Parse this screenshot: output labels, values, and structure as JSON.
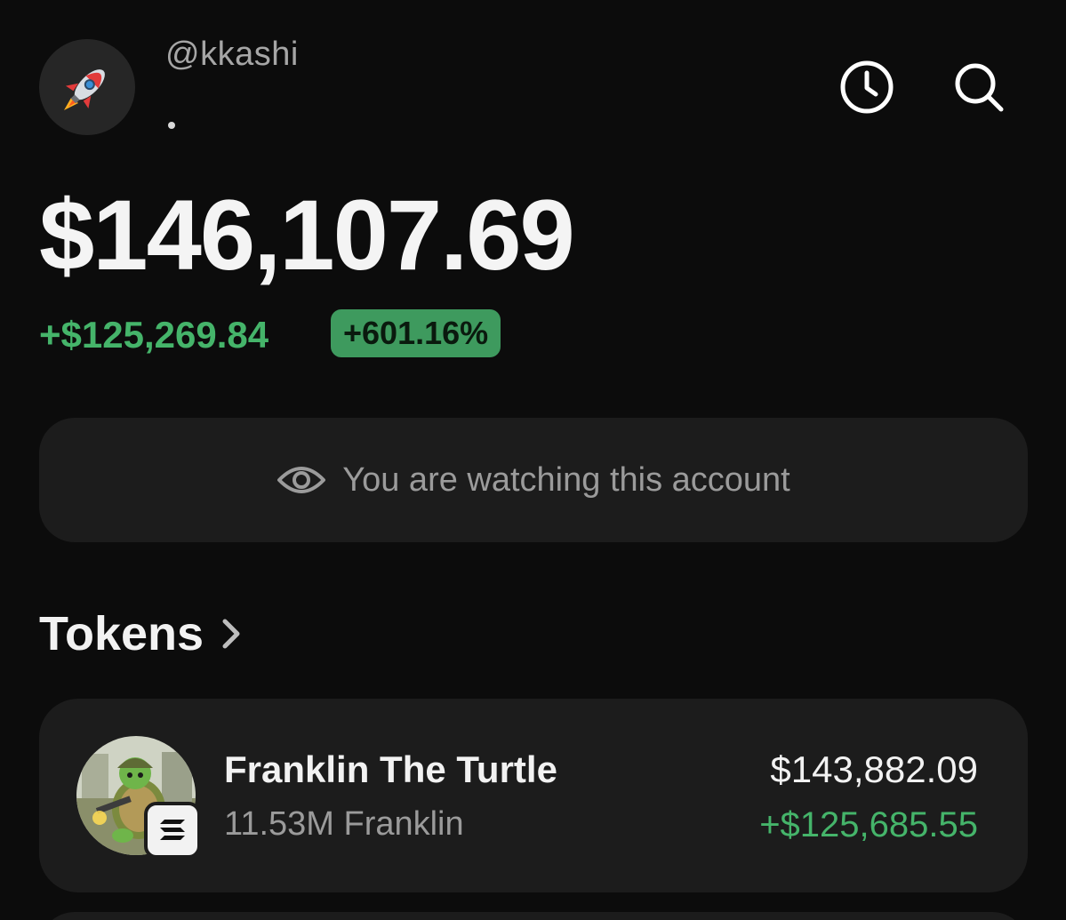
{
  "profile": {
    "handle": "@kkashi",
    "avatar_icon": "rocket-icon"
  },
  "header": {
    "history_icon": "clock-icon",
    "search_icon": "search-icon"
  },
  "portfolio": {
    "balance": "$146,107.69",
    "change_amount": "+$125,269.84",
    "change_percent": "+601.16%"
  },
  "watch_banner": {
    "icon": "eye-icon",
    "text": "You are watching this account"
  },
  "tokens": {
    "title": "Tokens",
    "items": [
      {
        "name": "Franklin The Turtle",
        "amount": "11.53M Franklin",
        "value": "$143,882.09",
        "pnl": "+$125,685.55",
        "chain_icon": "solana-icon"
      }
    ]
  },
  "colors": {
    "background": "#0c0c0c",
    "card": "#1c1c1c",
    "positive": "#45b46a",
    "badge": "#3e9a5e"
  }
}
